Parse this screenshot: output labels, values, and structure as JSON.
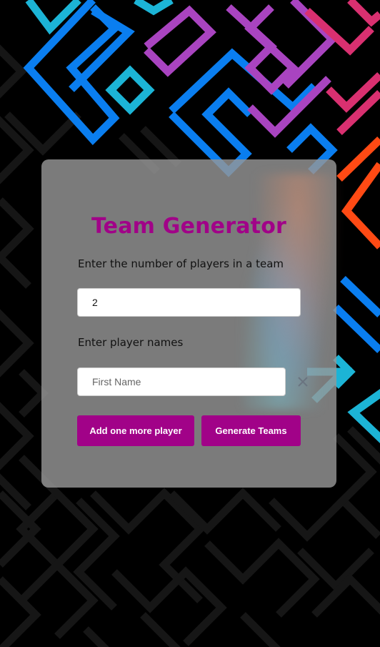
{
  "app": {
    "title": "Team Generator"
  },
  "team_size": {
    "label": "Enter the number of players in a team",
    "value": "2"
  },
  "players": {
    "label": "Enter player names",
    "name_placeholder": "First Name",
    "name_value": ""
  },
  "actions": {
    "add_label": "Add one more player",
    "generate_label": "Generate Teams"
  },
  "icons": {
    "remove_player": "close-icon"
  },
  "colors": {
    "accent": "#a10288",
    "background": "#000000",
    "card": "#969696"
  }
}
